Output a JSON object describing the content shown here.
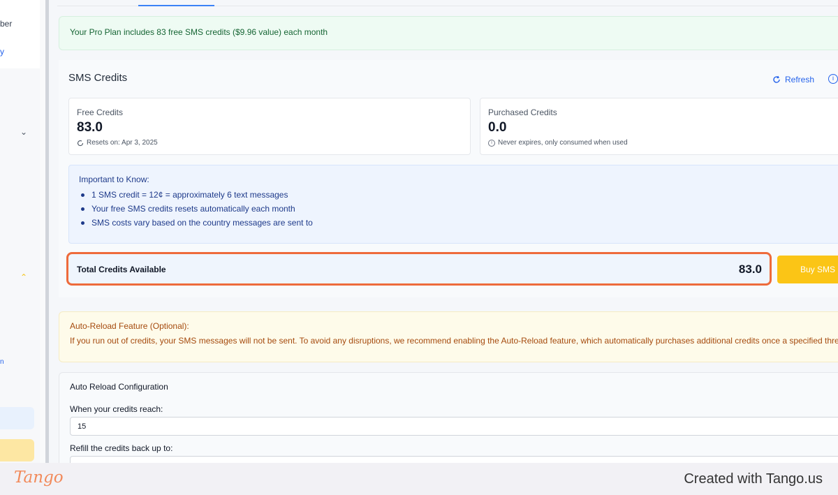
{
  "sidebar": {
    "partial_texts": [
      "ber",
      "y"
    ],
    "chevrons": [
      "⌄",
      "⌃"
    ]
  },
  "plan_banner": {
    "text": "Your Pro Plan includes 83 free SMS credits ($9.96 value) each month"
  },
  "sms_credits": {
    "title": "SMS Credits",
    "refresh_label": "Refresh",
    "free": {
      "label": "Free Credits",
      "value": "83.0",
      "note": "Resets on: Apr 3, 2025"
    },
    "purchased": {
      "label": "Purchased Credits",
      "value": "0.0",
      "note": "Never expires, only consumed when used"
    }
  },
  "important": {
    "title": "Important to Know:",
    "items": [
      "1 SMS credit = 12¢ = approximately 6 text messages",
      "Your free SMS credits resets automatically each month",
      "SMS costs vary based on the country messages are sent to"
    ]
  },
  "total": {
    "label": "Total Credits Available",
    "value": "83.0",
    "buy_label": "Buy SMS C"
  },
  "auto_reload": {
    "title": "Auto-Reload Feature (Optional):",
    "text": "If you run out of credits, your SMS messages will not be sent. To avoid any disruptions, we recommend enabling the Auto-Reload feature, which automatically purchases additional credits once a specified threshold"
  },
  "config": {
    "title": "Auto Reload Configuration",
    "threshold_label": "When your credits reach:",
    "threshold_value": "15",
    "refill_label": "Refill the credits back up to:",
    "refill_value": ""
  },
  "footer": {
    "logo": "Tango",
    "created": "Created with Tango.us"
  },
  "colors": {
    "highlight": "#ee6b3b",
    "buy_button": "#fbc516",
    "accent": "#2563eb"
  }
}
